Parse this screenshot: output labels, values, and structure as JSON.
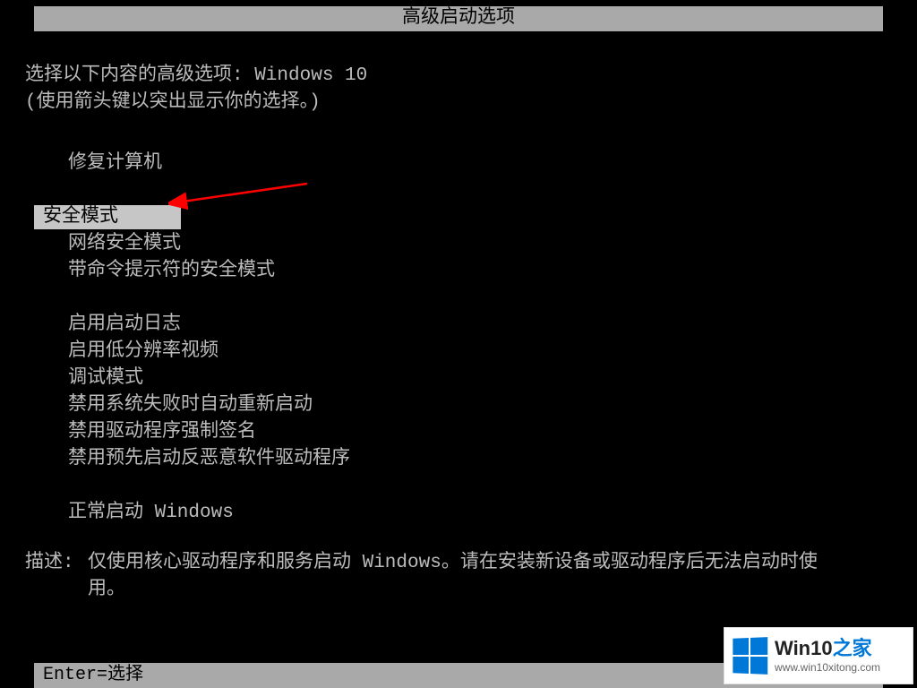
{
  "title": "高级启动选项",
  "instruction1": "选择以下内容的高级选项: Windows 10",
  "instruction2": "(使用箭头键以突出显示你的选择。)",
  "menu": {
    "group1": [
      "修复计算机"
    ],
    "group2": [
      "安全模式",
      "网络安全模式",
      "带命令提示符的安全模式"
    ],
    "group3": [
      "启用启动日志",
      "启用低分辨率视频",
      "调试模式",
      "禁用系统失败时自动重新启动",
      "禁用驱动程序强制签名",
      "禁用预先启动反恶意软件驱动程序"
    ],
    "group4": [
      "正常启动 Windows"
    ],
    "selected_index": 1
  },
  "description": {
    "label": "描述:",
    "text": "仅使用核心驱动程序和服务启动 Windows。请在安装新设备或驱动程序后无法启动时使用。"
  },
  "bottom_bar": "Enter=选择",
  "watermark": {
    "title_prefix": "Win10",
    "title_suffix": "之家",
    "url": "www.win10xitong.com"
  },
  "annotation": {
    "arrow_color": "#ff0000"
  }
}
